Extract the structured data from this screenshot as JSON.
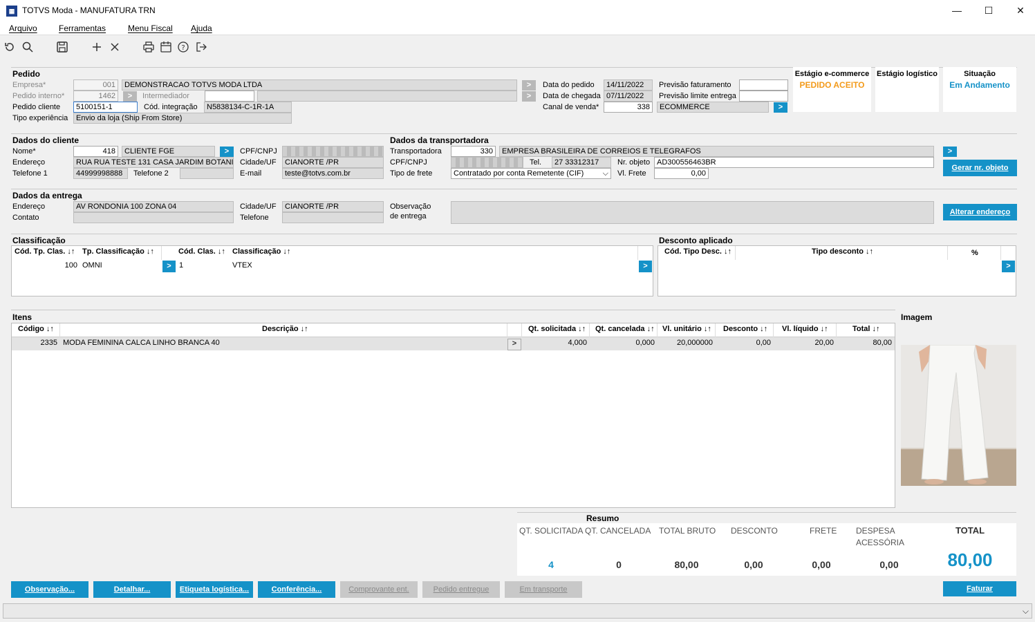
{
  "window": {
    "title": "TOTVS Moda - MANUFATURA TRN",
    "minimize": "—",
    "maximize": "☐",
    "close": "✕"
  },
  "menu": [
    "Arquivo",
    "Ferramentas",
    "Menu Fiscal",
    "Ajuda"
  ],
  "toolbar_icons": [
    "refresh-icon",
    "search-icon",
    "save-icon",
    "add-icon",
    "delete-icon",
    "print-icon",
    "calendar-icon",
    "help-icon",
    "exit-icon"
  ],
  "pedido": {
    "section": "Pedido",
    "empresa_label": "Empresa*",
    "empresa_code": "001",
    "empresa_name": "DEMONSTRACAO TOTVS MODA LTDA",
    "pedido_interno_label": "Pedido interno*",
    "pedido_interno": "1462",
    "intermediador_label": "Intermediador",
    "pedido_cliente_label": "Pedido cliente",
    "pedido_cliente": "5100151-1",
    "cod_integracao_label": "Cód. integração",
    "cod_integracao": "N5838134-C-1R-1A",
    "tipo_experiencia_label": "Tipo experiência",
    "tipo_experiencia": "Envio da loja (Ship From Store)",
    "data_pedido_label": "Data do pedido",
    "data_pedido": "14/11/2022",
    "data_chegada_label": "Data de chegada",
    "data_chegada": "07/11/2022",
    "canal_venda_label": "Canal de venda*",
    "canal_venda_code": "338",
    "canal_venda_name": "ECOMMERCE",
    "previsao_faturamento_label": "Previsão faturamento",
    "previsao_limite_label": "Previsão limite entrega"
  },
  "status": {
    "ecommerce_label": "Estágio e-commerce",
    "ecommerce_value": "PEDIDO ACEITO",
    "logistico_label": "Estágio logístico",
    "situacao_label": "Situação",
    "situacao_value": "Em Andamento",
    "colors": {
      "ecommerce": "#f39a1a",
      "situacao": "#1592c8"
    }
  },
  "cliente": {
    "section": "Dados do cliente",
    "nome_label": "Nome*",
    "nome_code": "418",
    "nome": "CLIENTE FGE",
    "endereco_label": "Endereço",
    "endereco": "RUA RUA TESTE 131 CASA JARDIM BOTANICO",
    "telefone1_label": "Telefone 1",
    "telefone1": "44999998888",
    "telefone2_label": "Telefone 2",
    "cpf_label": "CPF/CNPJ",
    "cidade_label": "Cidade/UF",
    "cidade": "CIANORTE /PR",
    "email_label": "E-mail",
    "email": "teste@totvs.com.br"
  },
  "transportadora": {
    "section": "Dados da transportadora",
    "transportadora_label": "Transportadora",
    "code": "330",
    "name": "EMPRESA BRASILEIRA DE CORREIOS E TELEGRAFOS",
    "cpf_label": "CPF/CNPJ",
    "tel_label": "Tel.",
    "tel": "27 33312317",
    "nr_objeto_label": "Nr. objeto",
    "nr_objeto": "AD300556463BR",
    "tipo_frete_label": "Tipo de frete",
    "tipo_frete": "Contratado por conta Remetente (CIF)",
    "vl_frete_label": "Vl. Frete",
    "vl_frete": "0,00",
    "gerar_button": "Gerar nr. objeto"
  },
  "entrega": {
    "section": "Dados da entrega",
    "endereco_label": "Endereço",
    "endereco": "AV RONDONIA 100  ZONA 04",
    "contato_label": "Contato",
    "cidade_label": "Cidade/UF",
    "cidade": "CIANORTE /PR",
    "telefone_label": "Telefone",
    "observacao_label1": "Observação",
    "observacao_label2": "de entrega",
    "alterar_button": "Alterar endereço"
  },
  "classificacao": {
    "section": "Classificação",
    "headers": [
      "Cód. Tp. Clas. ↓↑",
      "Tp. Classificação ↓↑",
      "Cód. Clas. ↓↑",
      "Classificação ↓↑"
    ],
    "row": {
      "cod_tp": "100",
      "tp": "OMNI",
      "cod": "1",
      "clas": "VTEX"
    }
  },
  "desconto": {
    "section": "Desconto aplicado",
    "headers": [
      "Cód. Tipo Desc. ↓↑",
      "Tipo desconto ↓↑",
      "%"
    ]
  },
  "itens": {
    "section": "Itens",
    "headers": [
      "Código ↓↑",
      "Descrição ↓↑",
      "Qt. solicitada ↓↑",
      "Qt. cancelada ↓↑",
      "Vl. unitário ↓↑",
      "Desconto ↓↑",
      "Vl. líquido ↓↑",
      "Total ↓↑"
    ],
    "rows": [
      {
        "codigo": "2335",
        "descricao": "MODA FEMININA CALCA LINHO BRANCA 40",
        "qt_solicitada": "4,000",
        "qt_cancelada": "0,000",
        "vl_unitario": "20,000000",
        "desconto": "0,00",
        "vl_liquido": "20,00",
        "total": "80,00"
      }
    ]
  },
  "imagem": {
    "label": "Imagem"
  },
  "resumo": {
    "section": "Resumo",
    "qt_solicitada_label": "QT. SOLICITADA",
    "qt_solicitada": "4",
    "qt_cancelada_label": "QT. CANCELADA",
    "qt_cancelada": "0",
    "total_bruto_label": "TOTAL BRUTO",
    "total_bruto": "80,00",
    "desconto_label": "DESCONTO",
    "desconto": "0,00",
    "frete_label": "FRETE",
    "frete": "0,00",
    "despesa_label1": "DESPESA",
    "despesa_label2": "ACESSÓRIA",
    "despesa": "0,00",
    "total_label": "TOTAL",
    "total": "80,00"
  },
  "buttons": {
    "observacao": "Observação...",
    "detalhar": "Detalhar...",
    "etiqueta": "Etiqueta logística...",
    "conferencia": "Conferência...",
    "comprovante": "Comprovante ent.",
    "pedido_entregue": "Pedido entregue",
    "em_transporte": "Em transporte",
    "faturar": "Faturar"
  },
  "glyphs": {
    "arrow": ">",
    "chevron_down": "⌵"
  }
}
